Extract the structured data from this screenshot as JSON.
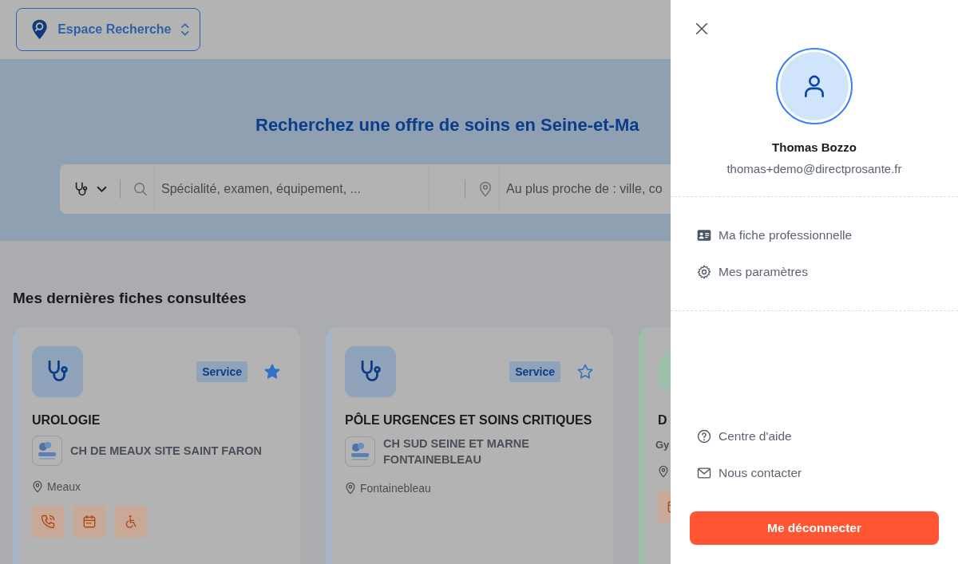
{
  "space_switcher": {
    "label": "Espace Recherche"
  },
  "banner": {
    "title": "Recherchez une offre de soins en Seine-et-Ma",
    "search": {
      "query_placeholder": "Spécialité, examen, équipement, ...",
      "location_placeholder": "Au plus proche de : ville, co"
    }
  },
  "recent": {
    "title": "Mes dernières fiches consultées",
    "cards": [
      {
        "kind": "service",
        "color": "#a3b6ca",
        "badge": "Service",
        "favorite": true,
        "title": "UROLOGIE",
        "facility": "CH DE MEAUX SITE SAINT FARON",
        "location": "Meaux",
        "features": [
          {
            "kind": "phone"
          },
          {
            "kind": "calendar"
          },
          {
            "kind": "wheelchair"
          }
        ]
      },
      {
        "kind": "service",
        "color": "#a3b6ca",
        "badge": "Service",
        "favorite": false,
        "title": "PÔLE URGENCES ET SOINS CRITIQUES",
        "facility": "CH SUD SEINE ET MARNE FONTAINEBLEAU",
        "location": "Fontainebleau"
      },
      {
        "kind": "person",
        "color": "#9cc0ac",
        "title": "D",
        "subtitle": "Gy",
        "features": [
          {
            "kind": "calendar"
          }
        ]
      }
    ]
  },
  "drawer": {
    "user": {
      "name": "Thomas Bozzo",
      "email": "thomas+demo@directprosante.fr"
    },
    "menu": [
      {
        "kind": "id-card",
        "label": "Ma fiche professionnelle"
      },
      {
        "kind": "gear",
        "label": "Mes paramètres"
      }
    ],
    "help_menu": [
      {
        "kind": "help",
        "label": "Centre d'aide"
      },
      {
        "kind": "mail",
        "label": "Nous contacter"
      }
    ],
    "logout": "Me déconnecter"
  }
}
